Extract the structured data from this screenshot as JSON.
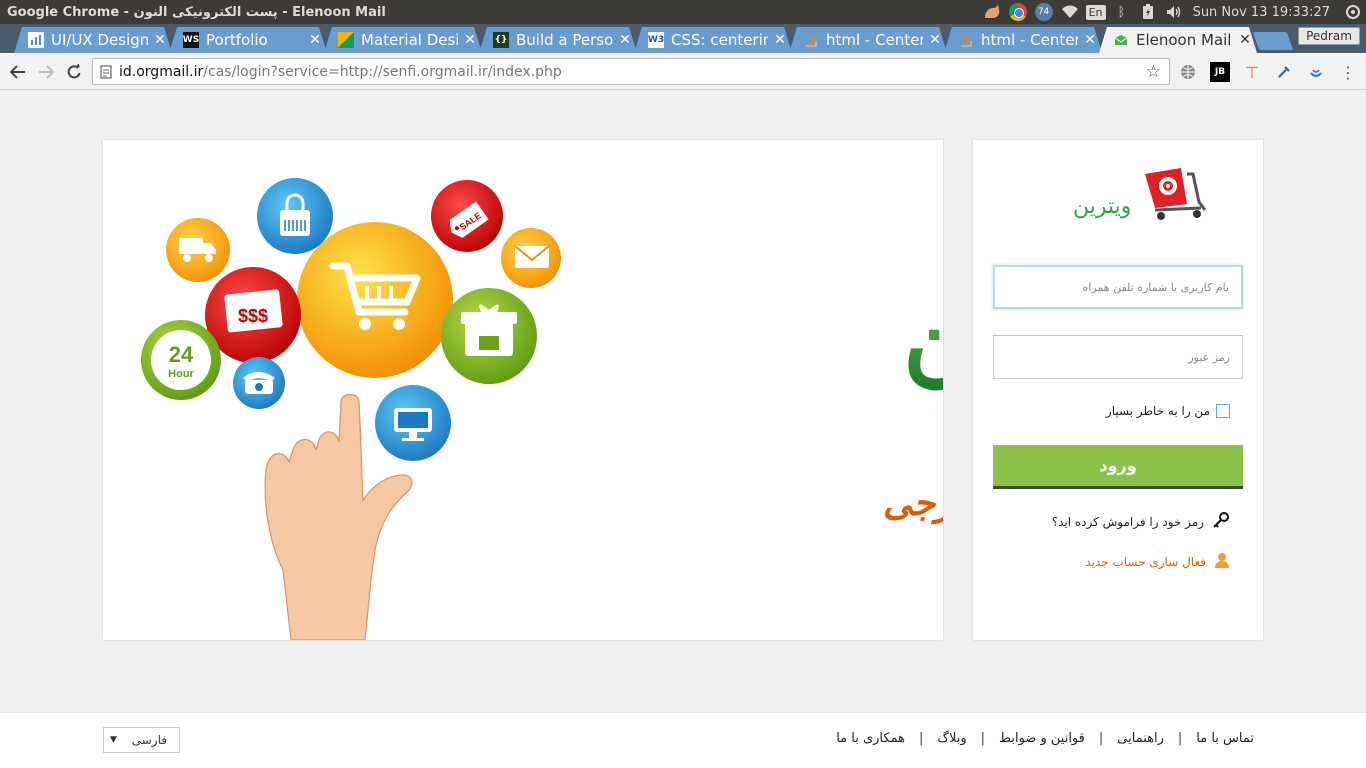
{
  "os": {
    "window_title": "Google Chrome - پست الکترونیکی النون - Elenoon Mail",
    "badge_count": "74",
    "keyboard_lang": "En",
    "clock": "Sun Nov 13 19:33:27"
  },
  "tabs": [
    {
      "label": "UI/UX Design",
      "favicon": "bar-chart-icon",
      "active": false
    },
    {
      "label": "Portfolio",
      "favicon": "ws-icon",
      "active": false
    },
    {
      "label": "Material Desi",
      "favicon": "material-icon",
      "active": false
    },
    {
      "label": "Build a Perso",
      "favicon": "code-icon",
      "active": false
    },
    {
      "label": "CSS: centering",
      "favicon": "w3c-icon",
      "active": false
    },
    {
      "label": "html - Center",
      "favicon": "stackoverflow-icon",
      "active": false
    },
    {
      "label": "html - Center",
      "favicon": "stackoverflow-icon",
      "active": false
    },
    {
      "label": "Elenoon Mail",
      "favicon": "mail-icon",
      "active": true
    }
  ],
  "profile_name": "Pedram",
  "address_bar": {
    "host": "id.orgmail.ir",
    "path": "/cas/login?service=http://senfi.orgmail.ir/index.php"
  },
  "banner": {
    "brand_title": "ویترین",
    "tagline": "ابزاری نوین برای تجارت خارجی",
    "bubble_texts": [
      "$$$",
      "24",
      "Hour",
      "SALE"
    ]
  },
  "login": {
    "brand": "ویترین",
    "username_placeholder": "نام کاربری یا شماره تلفن همراه",
    "password_placeholder": "رمز عبور",
    "remember_label": "من را به خاطر بسپار",
    "submit_label": "ورود",
    "forgot_label": "رمز خود را فراموش کرده اید؟",
    "activate_label": "فعال سازی حساب جدید"
  },
  "footer": {
    "links": [
      "تماس با ما",
      "راهنمایی",
      "قوانین و ضوابط",
      "وبلاگ",
      "همکاری با ما"
    ],
    "language_selected": "فارسی"
  },
  "colors": {
    "accent_green": "#8bc34a",
    "brand_green": "#35a34a",
    "activate_orange": "#e65c00",
    "tab_blue": "#6a9ccf"
  }
}
